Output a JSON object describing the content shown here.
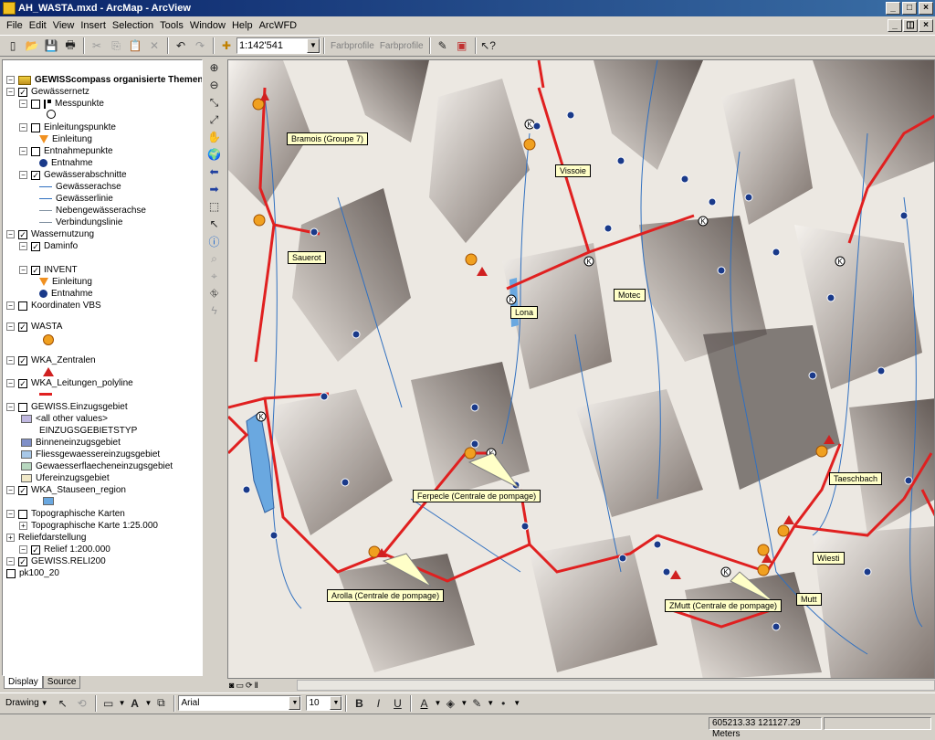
{
  "window": {
    "title": "AH_WASTA.mxd - ArcMap - ArcView"
  },
  "menu": [
    "File",
    "Edit",
    "View",
    "Insert",
    "Selection",
    "Tools",
    "Window",
    "Help",
    "ArcWFD"
  ],
  "toolbar": {
    "scale": "1:142'541",
    "farbprofile1": "Farbprofile",
    "farbprofile2": "Farbprofile"
  },
  "toc": {
    "root": "GEWISScompass organisierte Themen",
    "rows": [
      "Gewässernetz",
      "Messpunkte",
      "Einleitungspunkte",
      "Einleitung",
      "Entnahmepunkte",
      "Entnahme",
      "Gewässerabschnitte",
      "Gewässerachse",
      "Gewässerlinie",
      "Nebengewässerachse",
      "Verbindungslinie",
      "Wassernutzung",
      "Daminfo",
      "INVENT",
      "Einleitung",
      "Entnahme",
      "Koordinaten VBS",
      "WASTA",
      "WKA_Zentralen",
      "WKA_Leitungen_polyline",
      "GEWISS.Einzugsgebiet",
      "<all other values>",
      "EINZUGSGEBIETSTYP",
      "Binneneinzugsgebiet",
      "Fliessgewaessereinzugsgebiet",
      "Gewaesserflaecheneinzugsgebiet",
      "Ufereinzugsgebiet",
      "WKA_Stauseen_region",
      "Topographische Karten",
      "Topographische Karte 1:25.000",
      "Reliefdarstellung",
      "Relief 1:200.000",
      "GEWISS.RELI200",
      "pk100_20"
    ]
  },
  "tabs": {
    "display": "Display",
    "source": "Source"
  },
  "map_labels": [
    "Bramois (Groupe 7)",
    "Vissoie",
    "Sauerot",
    "Lona",
    "Motec",
    "Ferpecle (Centrale de pompage)",
    "Taeschbach",
    "Arolla (Centrale de pompage)",
    "Wiesti",
    "Mutt",
    "ZMutt (Centrale de pompage)"
  ],
  "map_symbols": {
    "dam_letter": "K"
  },
  "drawbar": {
    "drawing": "Drawing",
    "font": "Arial",
    "size": "10",
    "bold": "B",
    "italic": "I",
    "underline": "U",
    "text_tool": "A"
  },
  "status": {
    "coords": "605213.33  121127.29 Meters"
  },
  "colors": {
    "title_bar": "#0a246a",
    "line_red": "#e02020",
    "river_blue": "#3070c0",
    "lake_blue": "#6aa8e0",
    "label_yellow": "#ffffc8",
    "wasta_orange": "#f0a020"
  }
}
